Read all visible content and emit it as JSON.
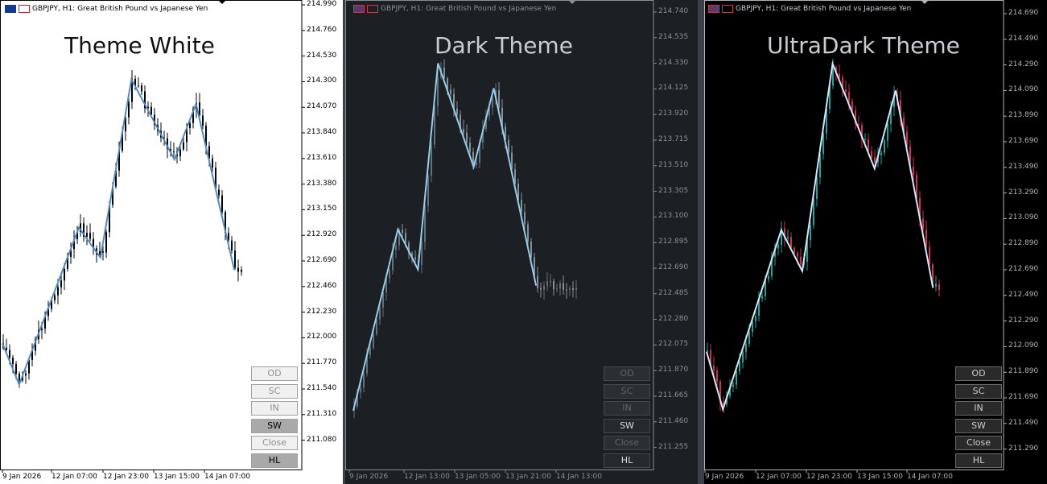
{
  "symbol_header": "GBPJPY, H1:  Great British Pound vs Japanese Yen",
  "buttons": [
    "OD",
    "SC",
    "IN",
    "SW",
    "Close",
    "HL"
  ],
  "panels": [
    {
      "id": "white",
      "theme_label": "Theme White",
      "colors": {
        "bg": "#ffffff",
        "text": "#000000",
        "candle_up": "#000000",
        "candle_down": "#000000",
        "zigzag": "#4b8bc8",
        "label": "#111111",
        "axis": "#000000"
      },
      "y_ticks": [
        "214.990",
        "214.760",
        "214.530",
        "214.300",
        "214.070",
        "213.840",
        "213.610",
        "213.380",
        "213.150",
        "212.920",
        "212.690",
        "212.460",
        "212.230",
        "212.000",
        "211.770",
        "211.540",
        "211.310",
        "211.080"
      ],
      "x_ticks": [
        "9 Jan 2026",
        "12 Jan 07:00",
        "12 Jan 23:00",
        "13 Jan 15:00",
        "14 Jan 07:00"
      ],
      "zigzag_y": [
        211.95,
        211.58,
        212.99,
        212.72,
        214.32,
        213.6,
        214.1,
        212.61
      ],
      "zigzag_x": [
        0.0,
        0.07,
        0.32,
        0.41,
        0.54,
        0.72,
        0.81,
        0.97
      ],
      "buttons_state": {
        "SW": "active",
        "HL": "active"
      }
    },
    {
      "id": "dark",
      "theme_label": "Dark Theme",
      "colors": {
        "bg": "#1c1f24",
        "text": "#8a8d93",
        "candle_up": "#6b6e73",
        "candle_down": "#8c8f94",
        "zigzag": "#8fd1f0",
        "label": "#c9ccd1",
        "axis": "#8a8d93"
      },
      "y_ticks": [
        "214.740",
        "214.535",
        "214.330",
        "214.125",
        "213.920",
        "213.715",
        "213.510",
        "213.305",
        "213.100",
        "212.895",
        "212.690",
        "212.485",
        "212.280",
        "212.075",
        "211.870",
        "211.665",
        "211.460",
        "211.255"
      ],
      "x_ticks": [
        "9 Jan 2026",
        "12 Jan 13:00",
        "13 Jan 05:00",
        "13 Jan 21:00",
        "14 Jan 13:00"
      ],
      "zigzag_y": [
        211.55,
        213.0,
        212.68,
        214.33,
        213.5,
        214.13,
        212.55
      ],
      "zigzag_x": [
        0.0,
        0.2,
        0.29,
        0.38,
        0.54,
        0.63,
        0.82
      ],
      "buttons_state": {
        "SW": "active",
        "HL": "active"
      }
    },
    {
      "id": "ultradark",
      "theme_label": "UltraDark Theme",
      "colors": {
        "bg": "#000000",
        "text": "#b0b3b8",
        "candle_up": "#1fa79a",
        "candle_down": "#d9304e",
        "zigzag": "#cfe9ff",
        "label": "#c9ccd1",
        "axis": "#b0b3b8"
      },
      "y_ticks": [
        "214.690",
        "214.490",
        "214.290",
        "214.090",
        "213.890",
        "213.690",
        "213.490",
        "213.290",
        "213.090",
        "212.890",
        "212.690",
        "212.490",
        "212.290",
        "212.090",
        "211.890",
        "211.690",
        "211.490",
        "211.290"
      ],
      "x_ticks": [
        "9 Jan 2026",
        "12 Jan 07:00",
        "12 Jan 23:00",
        "13 Jan 15:00",
        "14 Jan 07:00"
      ],
      "zigzag_y": [
        212.05,
        211.6,
        213.0,
        212.68,
        214.3,
        213.48,
        214.09,
        212.55
      ],
      "zigzag_x": [
        0.0,
        0.07,
        0.32,
        0.41,
        0.54,
        0.72,
        0.81,
        0.97
      ],
      "buttons_state": {
        "SW": "active",
        "HL": "active"
      }
    }
  ]
}
